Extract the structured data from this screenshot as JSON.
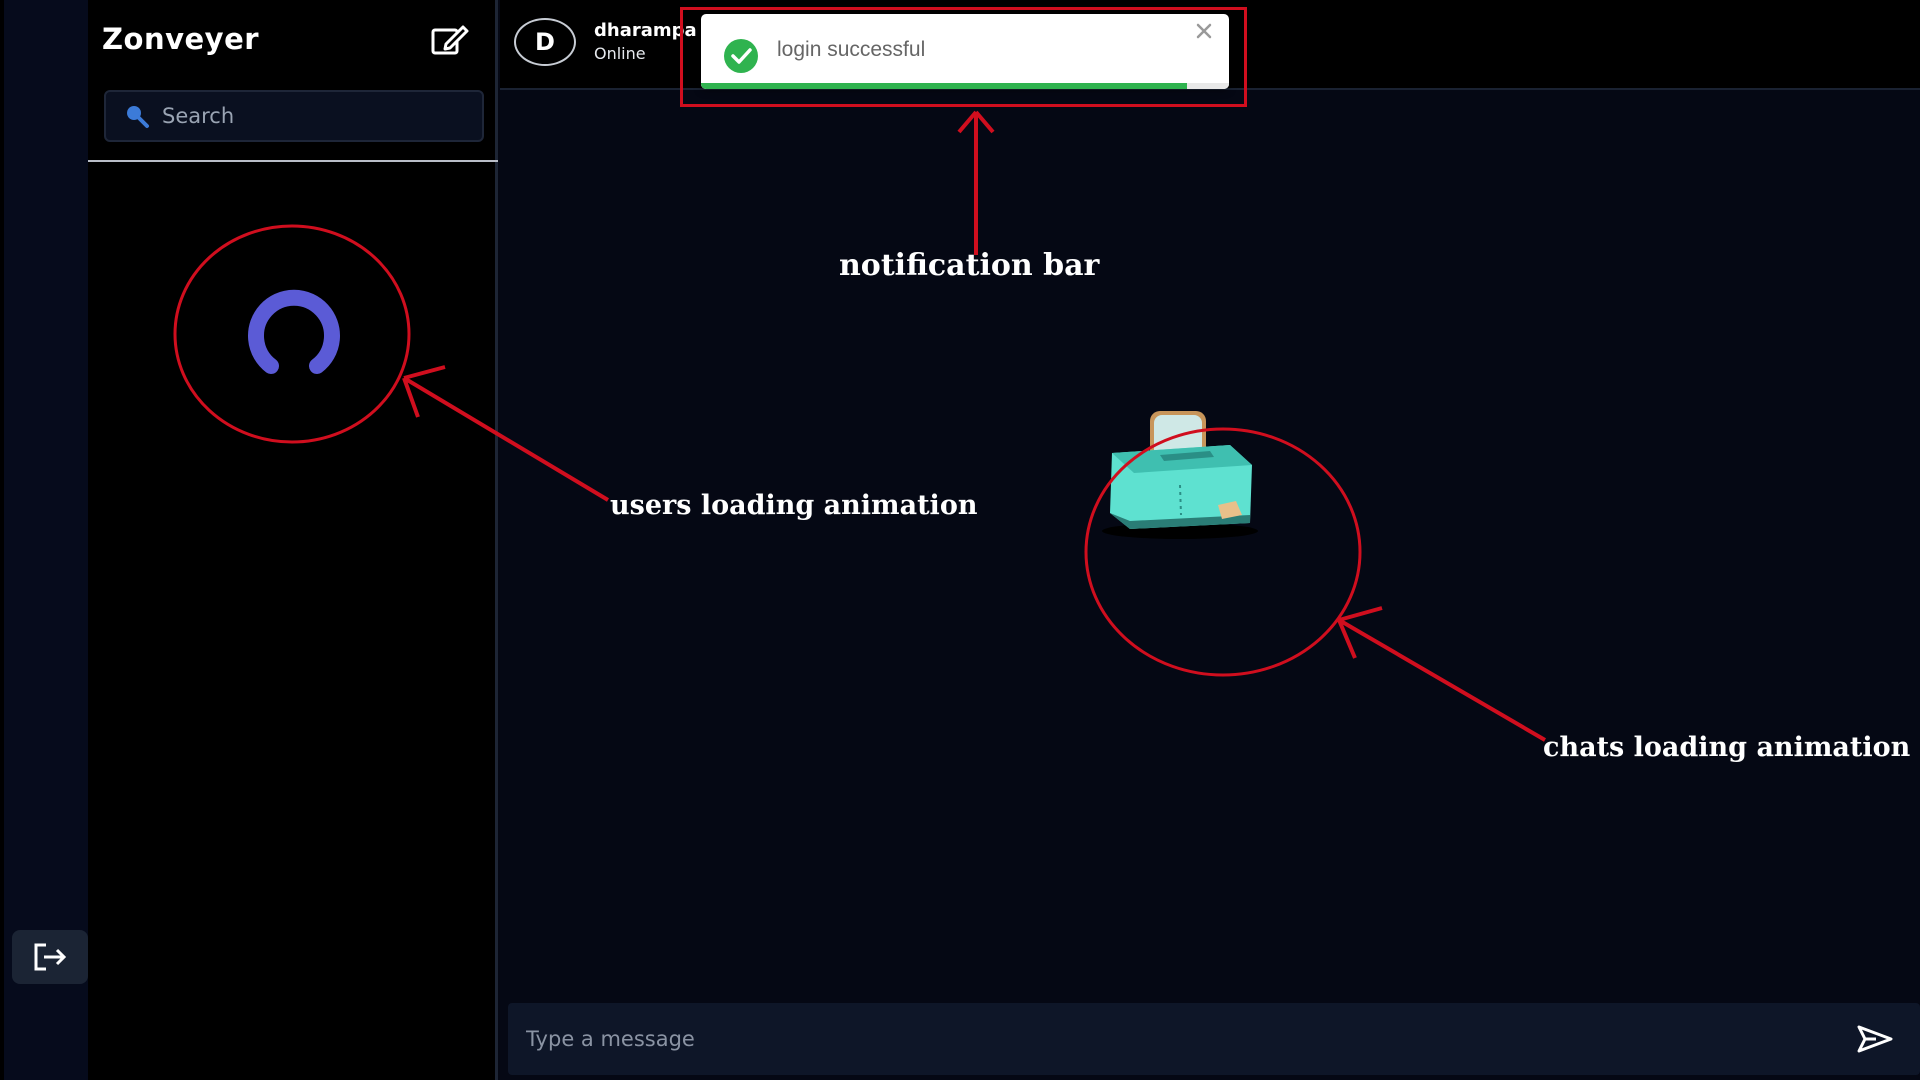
{
  "app": {
    "brand": "Zonveyer"
  },
  "sidebar": {
    "search_placeholder": "Search",
    "compose_icon": "edit-square-icon",
    "loading_indicator": "spinner"
  },
  "rail": {
    "logout_icon": "logout-arrow-icon"
  },
  "chat": {
    "header": {
      "avatar_letter": "D",
      "username": "dharampa",
      "status": "Online"
    },
    "composer_placeholder": "Type a message",
    "send_icon": "send-paper-plane-icon",
    "loading_indicator": "toaster-animation"
  },
  "notification": {
    "message": "login successful",
    "progress": 0.92,
    "icon": "check-circle-icon"
  },
  "annotations": {
    "notification": "notification bar",
    "users": "users loading animation",
    "chats": "chats loading animation"
  },
  "colors": {
    "accent_spinner": "#5b5bd6",
    "annotation_red": "#d00e1e",
    "success_green": "#2fb34f",
    "toaster_teal": "#5ee1d0"
  }
}
